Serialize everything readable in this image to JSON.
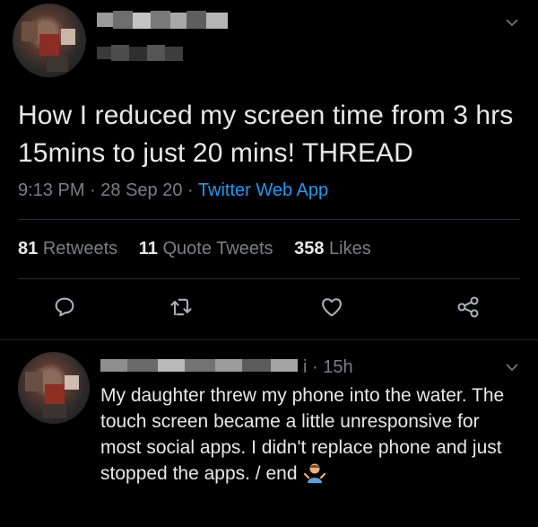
{
  "tweet": {
    "text": "How I reduced my screen time from 3 hrs 15mins to just 20 mins! THREAD",
    "time": "9:13 PM",
    "date": "28 Sep 20",
    "source": "Twitter Web App",
    "stats": {
      "retweets_count": "81",
      "retweets_label": "Retweets",
      "quotes_count": "11",
      "quotes_label": "Quote Tweets",
      "likes_count": "358",
      "likes_label": "Likes"
    },
    "icons": [
      "comment-icon",
      "retweet-icon",
      "like-icon",
      "share-icon",
      "chevron-down-icon"
    ]
  },
  "reply": {
    "time_suffix": "i · 15h",
    "text": "My daughter threw my phone into the water. The touch screen became a little unresponsive for most social apps. I didn't replace phone and just stopped the apps. / end",
    "emoji": "man-shrugging-emoji"
  },
  "colors": {
    "background": "#000000",
    "text": "#e8e8e8",
    "muted": "#7a7f85",
    "link": "#1d9bf0"
  }
}
